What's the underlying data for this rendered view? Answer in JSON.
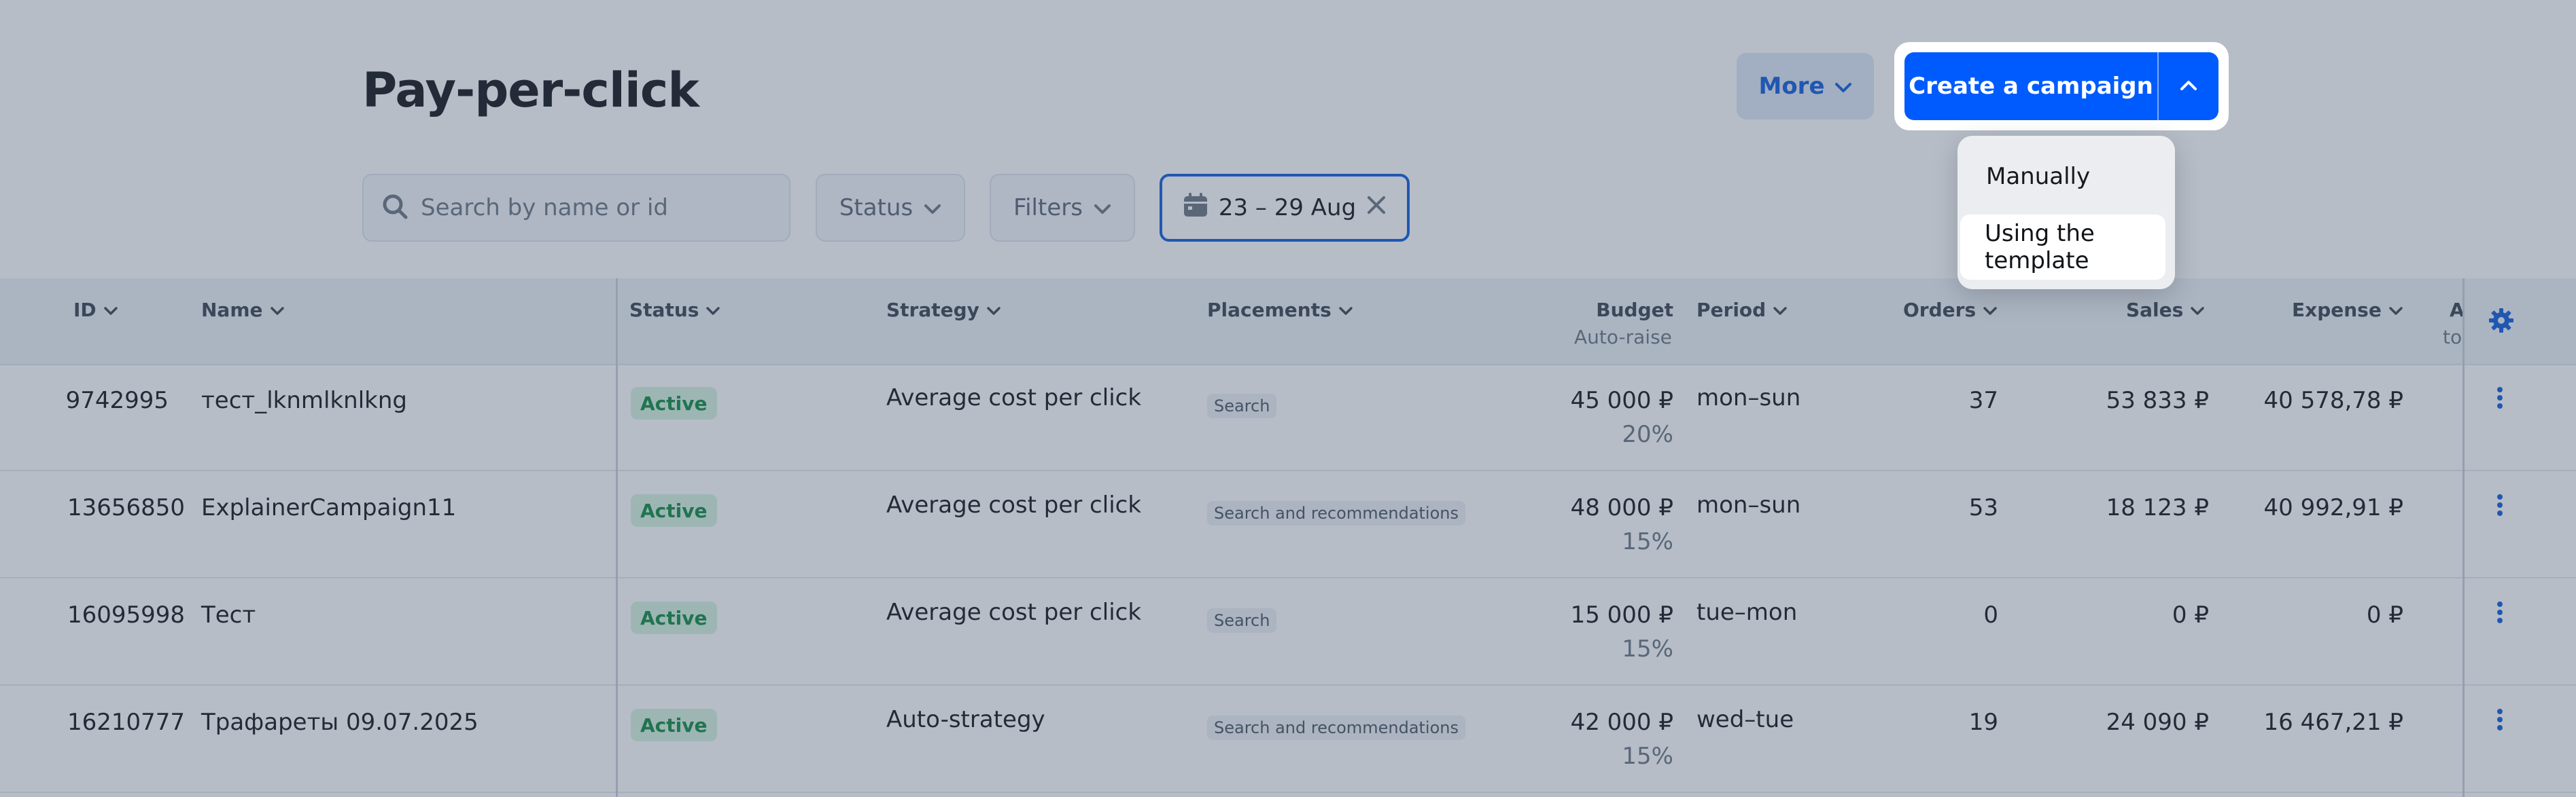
{
  "header": {
    "title": "Pay-per-click",
    "more_label": "More",
    "create_label": "Create a campaign"
  },
  "toolbar": {
    "search_placeholder": "Search by name or id",
    "status_label": "Status",
    "filters_label": "Filters",
    "date_range": "23 – 29 Aug"
  },
  "dropdown": {
    "items": [
      "Manually",
      "Using the template"
    ],
    "highlighted": "Using the template"
  },
  "table": {
    "columns": {
      "id": "ID",
      "name": "Name",
      "status": "Status",
      "strategy": "Strategy",
      "placements": "Placements",
      "budget": "Budget",
      "budget_sub": "Auto-raise",
      "period": "Period",
      "orders": "Orders",
      "sales": "Sales",
      "expense": "Expense",
      "extra": "A",
      "extra_sub": "to"
    },
    "rows": [
      {
        "id": "9742995",
        "name": "тест_lknmlknlkng",
        "status": "Active",
        "strategy": "Average cost per click",
        "placement": "Search",
        "budget": "45 000 ₽",
        "autoraise": "20%",
        "period": "mon–sun",
        "orders": "37",
        "sales": "53 833 ₽",
        "expense": "40 578,78 ₽"
      },
      {
        "id": "13656850",
        "name": "ExplainerCampaign11",
        "status": "Active",
        "strategy": "Average cost per click",
        "placement": "Search and recommendations",
        "budget": "48 000 ₽",
        "autoraise": "15%",
        "period": "mon–sun",
        "orders": "53",
        "sales": "18 123 ₽",
        "expense": "40 992,91 ₽"
      },
      {
        "id": "16095998",
        "name": "Тест",
        "status": "Active",
        "strategy": "Average cost per click",
        "placement": "Search",
        "budget": "15 000 ₽",
        "autoraise": "15%",
        "period": "tue–mon",
        "orders": "0",
        "sales": "0 ₽",
        "expense": "0 ₽"
      },
      {
        "id": "16210777",
        "name": "Трафареты 09.07.2025",
        "status": "Active",
        "strategy": "Auto-strategy",
        "placement": "Search and recommendations",
        "budget": "42 000 ₽",
        "autoraise": "15%",
        "period": "wed–tue",
        "orders": "19",
        "sales": "24 090 ₽",
        "expense": "16 467,21 ₽"
      }
    ]
  },
  "icons": {
    "search": "search-icon",
    "chevron_down": "chevron-down-icon",
    "chevron_up": "chevron-up-icon",
    "calendar": "calendar-icon",
    "close": "close-icon",
    "settings": "gear-icon",
    "more": "kebab-icon"
  },
  "colors": {
    "primary": "#005bff",
    "active_bg": "#d7f4e1",
    "active_text": "#0f8a3f",
    "overlay": "#3e526c"
  }
}
